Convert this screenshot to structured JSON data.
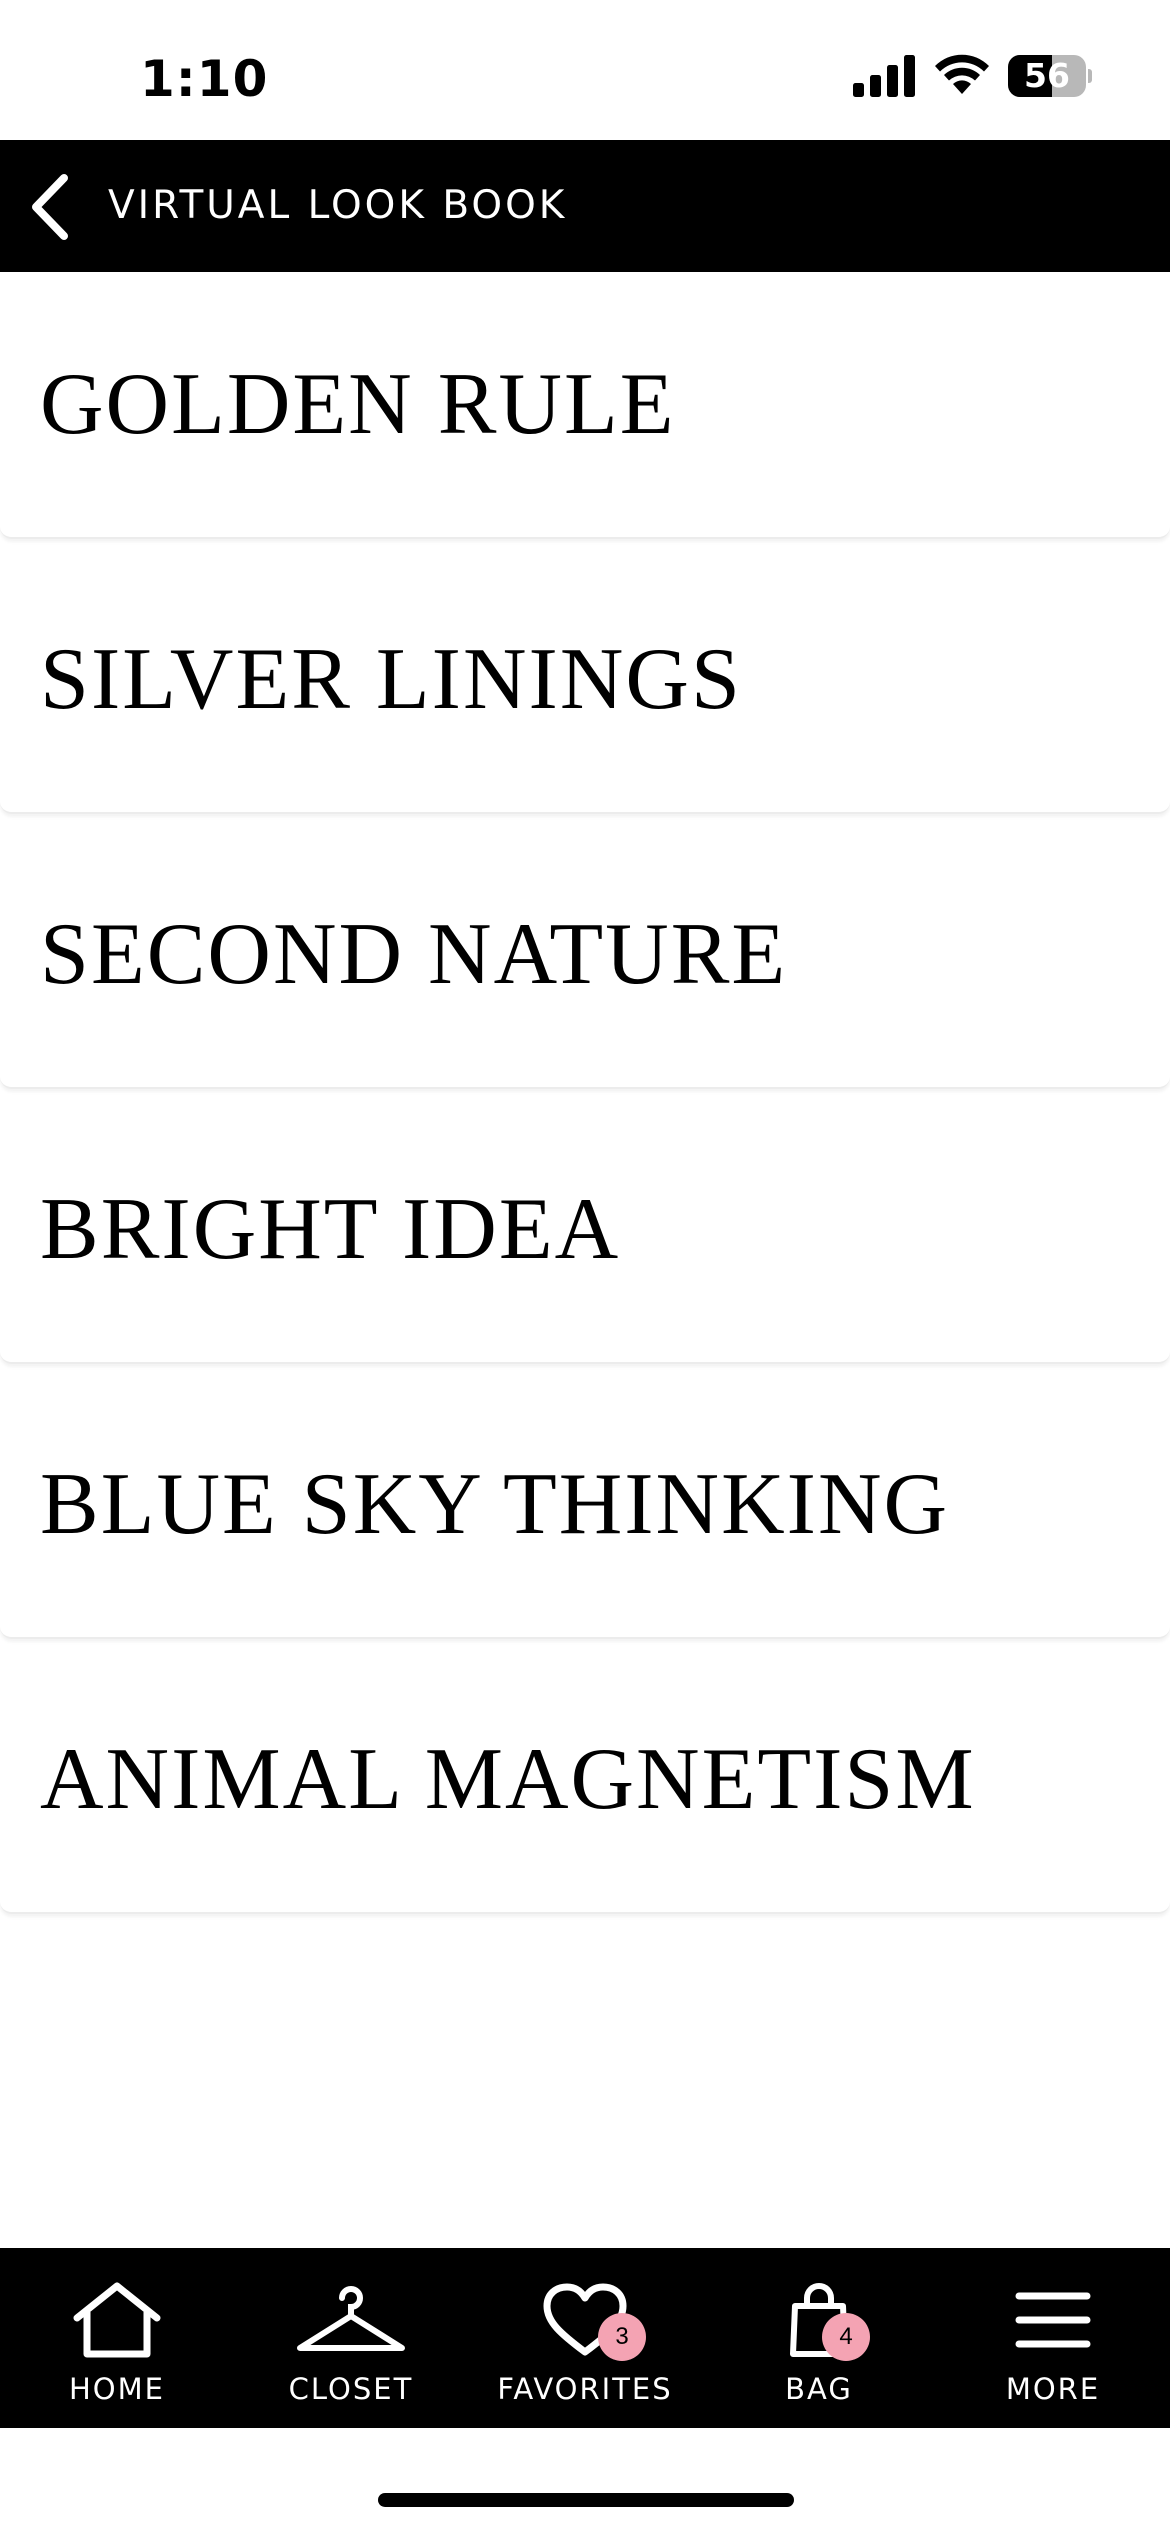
{
  "status_bar": {
    "time": "1:10",
    "battery_level": "56",
    "battery_fraction": 0.56
  },
  "header": {
    "back_icon": "chevron-left-icon",
    "title": "VIRTUAL LOOK BOOK"
  },
  "looks": [
    {
      "title": "GOLDEN RULE"
    },
    {
      "title": "SILVER LININGS"
    },
    {
      "title": "SECOND NATURE"
    },
    {
      "title": "BRIGHT IDEA"
    },
    {
      "title": "BLUE SKY THINKING"
    },
    {
      "title": "ANIMAL MAGNETISM"
    }
  ],
  "tab_bar": {
    "items": [
      {
        "label": "HOME",
        "icon": "home-icon"
      },
      {
        "label": "CLOSET",
        "icon": "hanger-icon"
      },
      {
        "label": "FAVORITES",
        "icon": "heart-icon",
        "badge": "3"
      },
      {
        "label": "BAG",
        "icon": "shopping-bag-icon",
        "badge": "4"
      },
      {
        "label": "MORE",
        "icon": "menu-icon"
      }
    ]
  },
  "colors": {
    "bar_background": "#000000",
    "page_background": "#ffffff",
    "badge": "#f4a3b3",
    "text_on_dark": "#ffffff"
  }
}
